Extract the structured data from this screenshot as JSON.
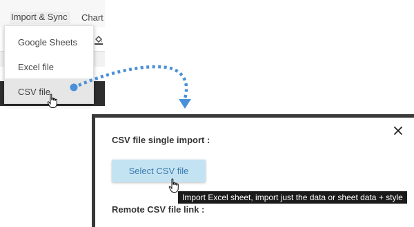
{
  "menubar": {
    "items": [
      {
        "label": "Import & Sync"
      },
      {
        "label": "Chart"
      }
    ]
  },
  "dropdown": {
    "items": [
      {
        "label": "Google Sheets"
      },
      {
        "label": "Excel file"
      },
      {
        "label": "CSV file",
        "highlighted": true
      }
    ]
  },
  "dialog": {
    "title": "CSV file single import :",
    "select_button": "Select CSV file",
    "remote_label": "Remote CSV file link :",
    "close_symbol": "×"
  },
  "tooltip": {
    "text": "Import Excel sheet, import just the data or sheet data + style"
  },
  "icons": [
    "fill-color-icon",
    "close-icon",
    "hand-pointer-icon",
    "dotted-arrow-icon"
  ],
  "colors": {
    "accent_blue": "#4a90d9",
    "button_bg": "#c4e3f2",
    "button_text": "#3a7ab0",
    "tooltip_bg": "#1a1a1a",
    "dark_frame": "#3a3a3a"
  }
}
